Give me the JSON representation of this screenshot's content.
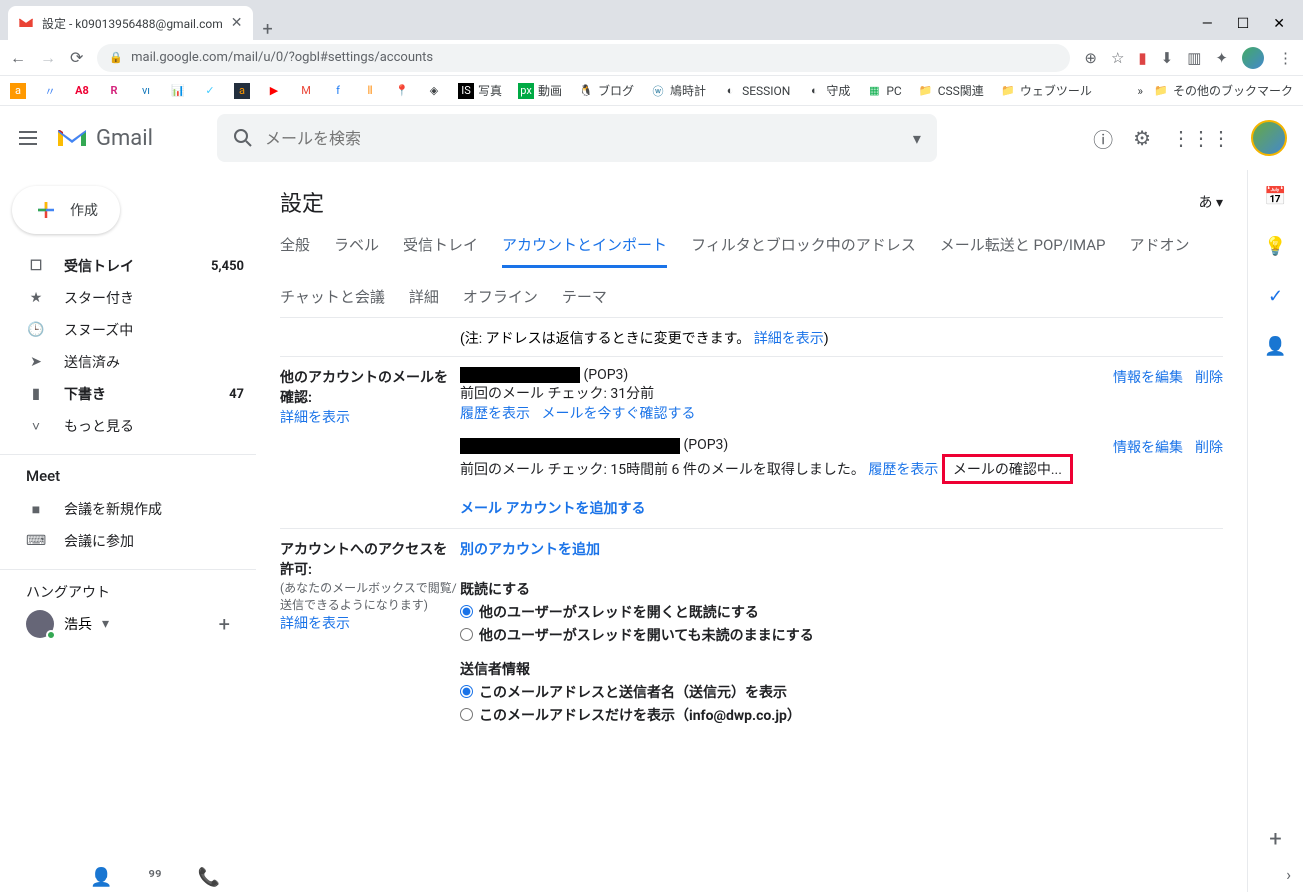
{
  "browser": {
    "tab_title": "設定 - k09013956488@gmail.com",
    "url": "mail.google.com/mail/u/0/?ogbl#settings/accounts",
    "new_tab": "+",
    "window": {
      "min": "—",
      "max": "☐",
      "close": "✕"
    }
  },
  "bookmarks": [
    {
      "label": ""
    },
    {
      "label": ""
    },
    {
      "label": "A8"
    },
    {
      "label": ""
    },
    {
      "label": ""
    },
    {
      "label": ""
    },
    {
      "label": ""
    },
    {
      "label": ""
    },
    {
      "label": ""
    },
    {
      "label": ""
    },
    {
      "label": ""
    },
    {
      "label": ""
    },
    {
      "label": ""
    },
    {
      "label": ""
    },
    {
      "label": ""
    },
    {
      "label": "写真"
    },
    {
      "label": "動画"
    },
    {
      "label": "ブログ"
    },
    {
      "label": "鳩時計"
    },
    {
      "label": "SESSION"
    },
    {
      "label": "守成"
    },
    {
      "label": "PC"
    },
    {
      "label": "CSS関連"
    },
    {
      "label": "ウェブツール"
    }
  ],
  "bookmarks_more": "»",
  "bookmarks_other": "その他のブックマーク",
  "gmail": {
    "brand": "Gmail",
    "search_placeholder": "メールを検索",
    "compose": "作成",
    "nav": [
      {
        "icon": "☐",
        "label": "受信トレイ",
        "count": "5,450",
        "bold": true
      },
      {
        "icon": "★",
        "label": "スター付き"
      },
      {
        "icon": "🕒",
        "label": "スヌーズ中"
      },
      {
        "icon": "➤",
        "label": "送信済み"
      },
      {
        "icon": "▮",
        "label": "下書き",
        "count": "47",
        "bold": true
      },
      {
        "icon": "˅",
        "label": "もっと見る"
      }
    ],
    "meet": {
      "title": "Meet",
      "items": [
        {
          "icon": "■",
          "label": "会議を新規作成"
        },
        {
          "icon": "⌨",
          "label": "会議に参加"
        }
      ]
    },
    "hangouts": {
      "title": "ハングアウト",
      "user": "浩兵"
    }
  },
  "settings": {
    "title": "設定",
    "lang": "あ ▾",
    "tabs": [
      "全般",
      "ラベル",
      "受信トレイ",
      "アカウントとインポート",
      "フィルタとブロック中のアドレス",
      "メール転送と POP/IMAP",
      "アドオン",
      "チャットと会議",
      "詳細",
      "オフライン",
      "テーマ"
    ],
    "active_tab": 3,
    "reply_note": "(注: アドレスは返信するときに変更できます。 ",
    "reply_detail": "詳細を表示",
    "close_paren": ")",
    "other_accounts": {
      "label": "他のアカウントのメールを確認:",
      "learn_more": "詳細を表示",
      "acct1": {
        "protocol": " (POP3)",
        "lastcheck": "前回のメール チェック: 31分前",
        "history": "履歴を表示",
        "checknow": "メールを今すぐ確認する",
        "edit": "情報を編集",
        "delete": "削除"
      },
      "acct2": {
        "protocol": " (POP3)",
        "lastcheck_a": "前回のメール チェック: 15時間前 6 件のメールを取得しました。 ",
        "history": "履歴を表示",
        "checking": "メールの確認中...",
        "edit": "情報を編集",
        "delete": "削除"
      },
      "add": "メール アカウントを追加する"
    },
    "grant": {
      "label": "アカウントへのアクセスを許可:",
      "sub": "(あなたのメールボックスで閲覧/送信できるようになります)",
      "learn_more": "詳細を表示",
      "add_link": "別のアカウントを追加",
      "read_title": "既読にする",
      "read_opt1": "他のユーザーがスレッドを開くと既読にする",
      "read_opt2": "他のユーザーがスレッドを開いても未読のままにする",
      "sender_title": "送信者情報",
      "sender_opt1": "このメールアドレスと送信者名（送信元）を表示",
      "sender_opt2": "このメールアドレスだけを表示（info@dwp.co.jp）"
    }
  }
}
